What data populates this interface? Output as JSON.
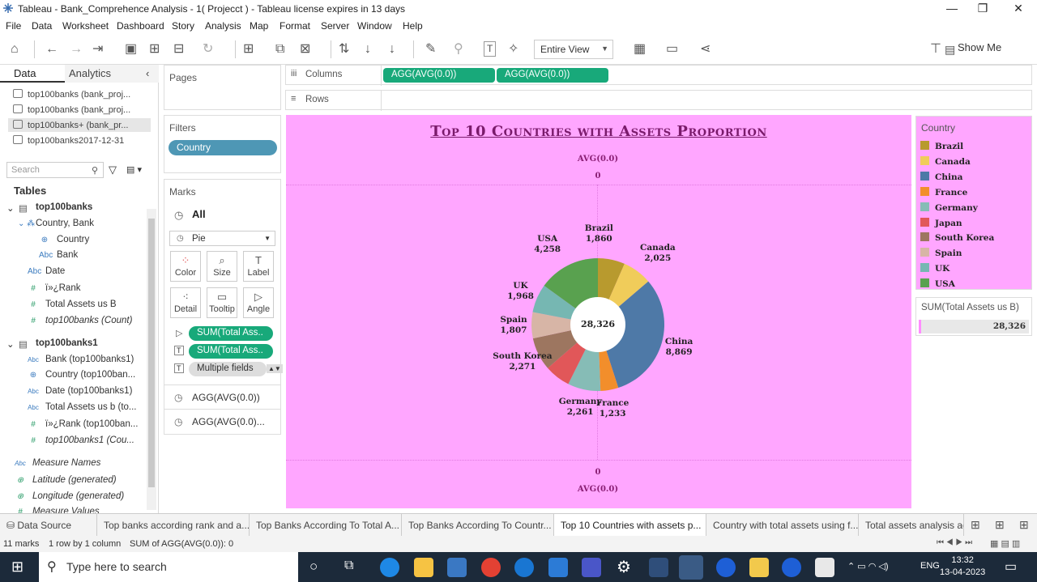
{
  "window": {
    "title": "Tableau - Bank_Comprehence Analysis - 1( Projecct ) - Tableau license expires in 13 days",
    "minimize": "—",
    "maximize": "❐",
    "close": "✕"
  },
  "menu": [
    "File",
    "Data",
    "Worksheet",
    "Dashboard",
    "Story",
    "Analysis",
    "Map",
    "Format",
    "Server",
    "Window",
    "Help"
  ],
  "toolbar": {
    "fit_option": "Entire View",
    "show_me": "Show Me"
  },
  "data_pane": {
    "tabs": [
      "Data",
      "Analytics"
    ],
    "sources": [
      "top100banks (bank_proj...",
      "top100banks (bank_proj...",
      "top100banks+ (bank_pr...",
      "top100banks2017-12-31"
    ],
    "search_placeholder": "Search",
    "tables_header": "Tables",
    "table1": {
      "name": "top100banks",
      "hierarchy": "Country, Bank",
      "fields": [
        {
          "label": "Country",
          "icon": "globe-icon",
          "type": "dim"
        },
        {
          "label": "Bank",
          "icon": "Abc",
          "type": "dim"
        },
        {
          "label": "Date",
          "icon": "Abc",
          "type": "dim"
        },
        {
          "label": "ï»¿Rank",
          "icon": "#",
          "type": "measure"
        },
        {
          "label": "Total Assets us B",
          "icon": "#",
          "type": "measure"
        },
        {
          "label": "top100banks (Count)",
          "icon": "#",
          "type": "measure"
        }
      ]
    },
    "table2": {
      "name": "top100banks1",
      "fields": [
        {
          "label": "Bank (top100banks1)",
          "icon": "Abc"
        },
        {
          "label": "Country (top100ban...",
          "icon": "⊕"
        },
        {
          "label": "Date (top100banks1)",
          "icon": "Abc"
        },
        {
          "label": "Total Assets us b (to...",
          "icon": "Abc"
        },
        {
          "label": "ï»¿Rank (top100ban...",
          "icon": "#"
        },
        {
          "label": "top100banks1 (Cou...",
          "icon": "#"
        }
      ]
    },
    "extra_fields": [
      {
        "label": "Measure Names",
        "icon": "Abc"
      },
      {
        "label": "Latitude (generated)",
        "icon": "⊕"
      },
      {
        "label": "Longitude (generated)",
        "icon": "⊕"
      },
      {
        "label": "Measure Values",
        "icon": "#"
      }
    ]
  },
  "pages_label": "Pages",
  "filters": {
    "label": "Filters",
    "pill": "Country"
  },
  "marks": {
    "label": "Marks",
    "all": "All",
    "mark_type": "Pie",
    "buttons": [
      "Color",
      "Size",
      "Label",
      "Detail",
      "Tooltip",
      "Angle"
    ],
    "pills": [
      "SUM(Total Ass..",
      "SUM(Total Ass..",
      "Multiple fields"
    ],
    "agg1": "AGG(AVG(0.0))",
    "agg2": "AGG(AVG(0.0)..."
  },
  "shelves": {
    "columns_label": "Columns",
    "rows_label": "Rows",
    "column_pills": [
      "AGG(AVG(0.0))",
      "AGG(AVG(0.0))"
    ]
  },
  "view": {
    "title": "Top 10 Countries with Assets Proportion",
    "axis_top_label": "AVG(0.0)",
    "axis_top_value": "0",
    "axis_bottom_value": "0",
    "axis_bottom_label": "AVG(0.0)",
    "center_total": "28,326"
  },
  "chart_data": {
    "type": "pie",
    "title": "Top 10 Countries with Assets Proportion",
    "style": "donut",
    "total": 28326,
    "categories": [
      "Brazil",
      "Canada",
      "China",
      "France",
      "Germany",
      "Japan",
      "South Korea",
      "Spain",
      "UK",
      "USA"
    ],
    "values": [
      1860,
      2025,
      8869,
      1233,
      2261,
      1774,
      2271,
      1807,
      1968,
      4258
    ],
    "labels_shown": [
      "1,860",
      "2,025",
      "8,869",
      "1,233",
      "2,261",
      "",
      "2,271",
      "1,807",
      "1,968",
      "4,258"
    ],
    "colors": [
      "#b89a2e",
      "#f0cc5a",
      "#4e79a7",
      "#f28e2b",
      "#86bcb6",
      "#e15759",
      "#9d7660",
      "#d7b5a6",
      "#76b7b2",
      "#59a14f"
    ]
  },
  "legend": {
    "title": "Country",
    "items": [
      "Brazil",
      "Canada",
      "China",
      "France",
      "Germany",
      "Japan",
      "South Korea",
      "Spain",
      "UK",
      "USA"
    ]
  },
  "sum_card": {
    "title": "SUM(Total Assets us B)",
    "value": "28,326"
  },
  "sheet_tabs": [
    "Data Source",
    "Top banks according rank and a...",
    "Top Banks According To Total A...",
    "Top Banks According To Countr...",
    "Top 10 Countries with assets p...",
    "Country with total assets using f...",
    "Total assets analysis acc"
  ],
  "status": {
    "marks": "11 marks",
    "rows": "1 row by 1 column",
    "sum": "SUM of AGG(AVG(0.0)): 0"
  },
  "taskbar": {
    "search_placeholder": "Type here to search",
    "lang": "ENG",
    "time": "13:32",
    "date": "13-04-2023"
  }
}
